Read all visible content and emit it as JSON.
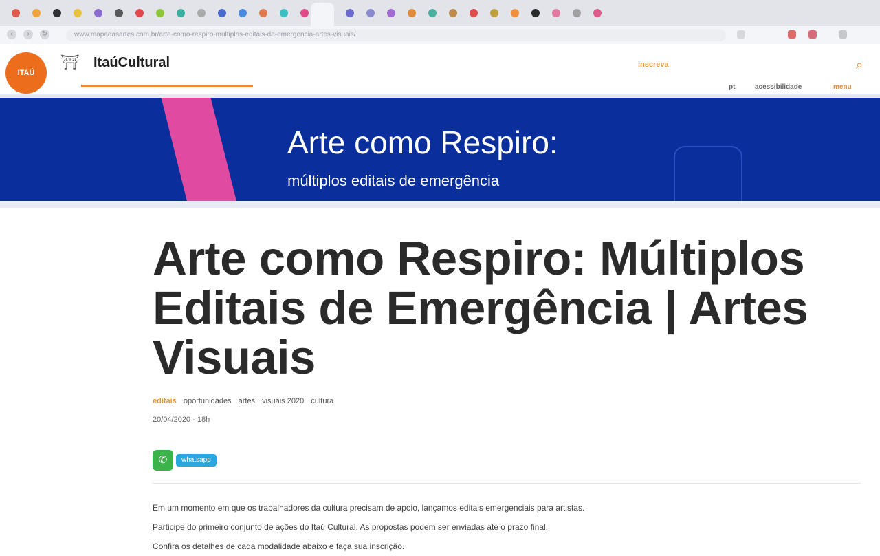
{
  "browser": {
    "url": "www.mapadasartes.com.br/arte-como-respiro-multiplos-editais-de-emergencia-artes-visuais/",
    "tab_colors": [
      "#e05a4a",
      "#f0a33a",
      "#333333",
      "#e8c23a",
      "#8a6ad0",
      "#5a5a5a",
      "#e04a4a",
      "#8ec63a",
      "#3ab0a0",
      "#aaaaaa",
      "#4a6ad0",
      "#4a8ae0",
      "#e07a4a",
      "#3ac0c0",
      "#e04a8a",
      "#6a6ad0",
      "#8a8ad0",
      "#a06ad0",
      "#e08a3a",
      "#4ab0a0",
      "#c08a4a",
      "#e04a4a",
      "#c0a03a",
      "#f0903a",
      "#2a2a2a",
      "#e07aa0",
      "#a0a0a0",
      "#e05a8a"
    ]
  },
  "site": {
    "logo_text": "ITAÚ",
    "logo_mark": "⛩",
    "title": "ItaúCultural",
    "header_link": "inscreva",
    "search_icon": "magnifier-icon",
    "sub_links": [
      "pt",
      "acessibilidade",
      "menu"
    ],
    "colors": {
      "brand_orange": "#ec6d1c",
      "banner_blue": "#0a2f9c",
      "stripe_pink": "#e04aa0"
    }
  },
  "banner": {
    "title": "Arte como Respiro:",
    "subtitle": "múltiplos editais de emergência"
  },
  "article": {
    "title": "Arte como Respiro: Múltiplos Editais de Emergência | Artes Visuais",
    "category": "editais",
    "meta": [
      "oportunidades",
      "artes",
      "visuais 2020",
      "cultura"
    ],
    "date": "20/04/2020 · 18h",
    "share_label": "whatsapp",
    "body": [
      "Em um momento em que os trabalhadores da cultura precisam de apoio, lançamos editais emergenciais para artistas.",
      "Participe do primeiro conjunto de ações do Itaú Cultural. As propostas podem ser enviadas até o prazo final.",
      "Confira os detalhes de cada modalidade abaixo e faça sua inscrição."
    ]
  }
}
